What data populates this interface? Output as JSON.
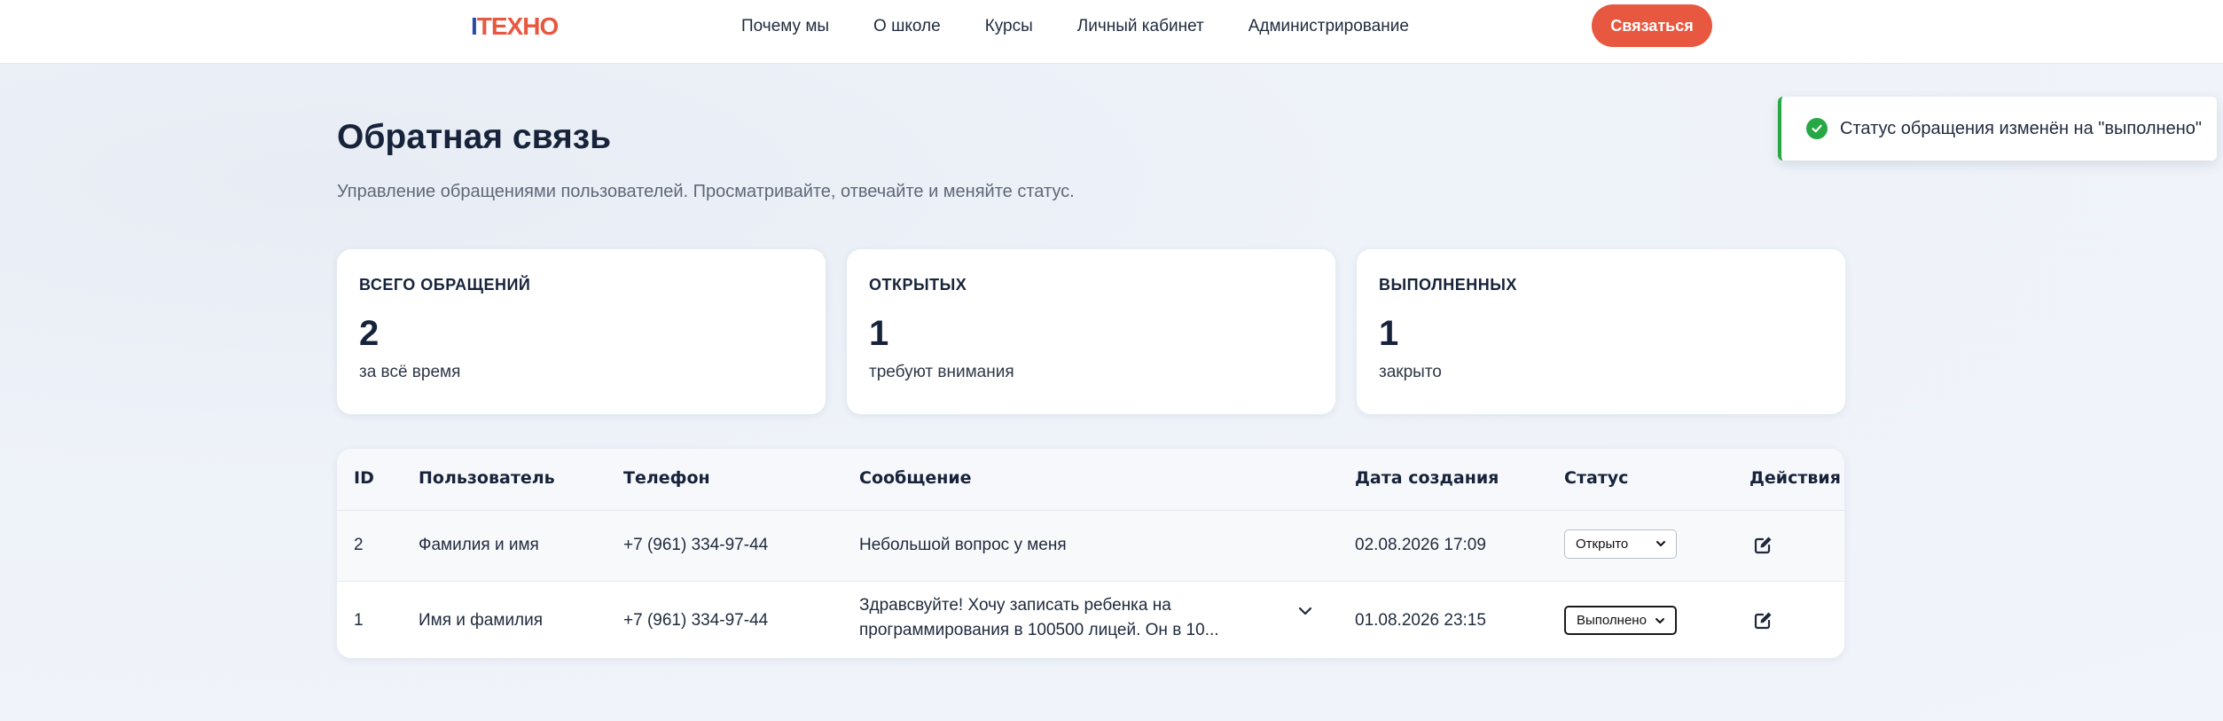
{
  "header": {
    "logo_prefix": "I",
    "logo_rest": "ТЕХНО",
    "nav": [
      "Почему мы",
      "О школе",
      "Курсы",
      "Личный кабинет",
      "Администрирование"
    ],
    "contact_label": "Связаться",
    "accent_color": "#e8573f",
    "brand_blue": "#2b4aa8"
  },
  "page": {
    "title": "Обратная связь",
    "subtitle": "Управление обращениями пользователей. Просматривайте, отвечайте и меняйте статус."
  },
  "toast": {
    "icon": "check-circle-icon",
    "text": "Статус обращения изменён на \"выполнено\"",
    "color": "#28a745"
  },
  "stats": [
    {
      "label": "ВСЕГО ОБРАЩЕНИЙ",
      "value": "2",
      "note": "за всё время"
    },
    {
      "label": "ОТКРЫТЫХ",
      "value": "1",
      "note": "требуют внимания"
    },
    {
      "label": "ВЫПОЛНЕННЫХ",
      "value": "1",
      "note": "закрыто"
    }
  ],
  "table": {
    "headers": [
      "ID",
      "Пользователь",
      "Телефон",
      "Сообщение",
      "Дата создания",
      "Статус",
      "Действия"
    ],
    "rows": [
      {
        "id": "2",
        "user": "Фамилия и имя",
        "phone": "+7 (961) 334-97-44",
        "message": "Небольшой вопрос у меня",
        "created": "02.08.2026 17:09",
        "status": "Открыто"
      },
      {
        "id": "1",
        "user": "Имя и фамилия",
        "phone": "+7 (961) 334-97-44",
        "message": "Здравсвуйте! Хочу записать ребенка на программирования в 100500 лицей. Он в 10...",
        "created": "01.08.2026 23:15",
        "status": "Выполнено"
      }
    ]
  }
}
